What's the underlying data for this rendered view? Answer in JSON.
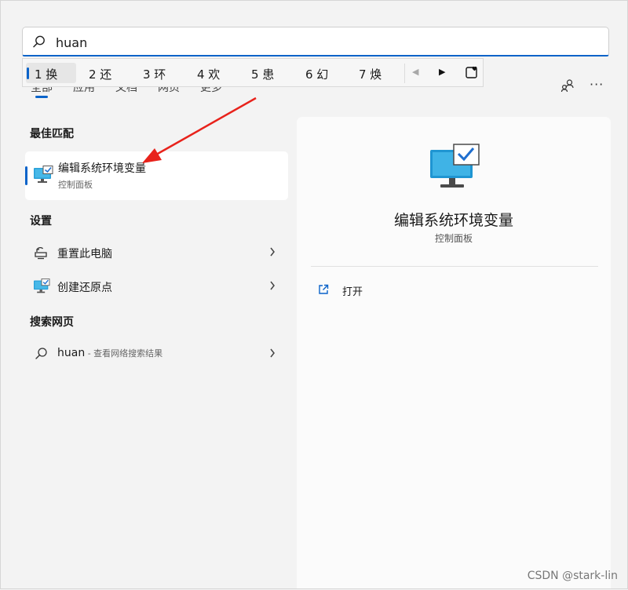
{
  "search": {
    "value": "huan",
    "placeholder": ""
  },
  "tabs": [
    "全部",
    "应用",
    "文档",
    "网页",
    "更多"
  ],
  "ime": {
    "candidates": [
      "1 换",
      "2 还",
      "3 环",
      "4 欢",
      "5 患",
      "6 幻",
      "7 焕"
    ],
    "selected_index": 0
  },
  "best_match": {
    "heading": "最佳匹配",
    "title": "编辑系统环境变量",
    "subtitle": "控制面板"
  },
  "settings": {
    "heading": "设置",
    "items": [
      {
        "label": "重置此电脑"
      },
      {
        "label": "创建还原点"
      }
    ]
  },
  "web_search": {
    "heading": "搜索网页",
    "query": "huan",
    "hint": " - 查看网络搜索结果"
  },
  "panel": {
    "title": "编辑系统环境变量",
    "subtitle": "控制面板",
    "open_label": "打开"
  },
  "watermark": "CSDN @stark-lin",
  "colors": {
    "accent": "#0a63c9",
    "arrow": "#e8221b"
  }
}
